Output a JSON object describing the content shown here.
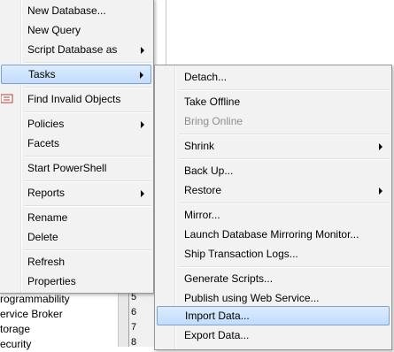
{
  "tree": {
    "rows": [
      "rogrammability",
      "ervice Broker",
      "torage",
      "ecurity"
    ]
  },
  "line_numbers": [
    "5",
    "6",
    "7",
    "8"
  ],
  "context_menu": {
    "items": [
      {
        "label": "New Database...",
        "submenu": false
      },
      {
        "label": "New Query",
        "submenu": false
      },
      {
        "label": "Script Database as",
        "submenu": true
      },
      {
        "label": "Tasks",
        "submenu": true,
        "highlighted": true
      },
      {
        "label": "Find Invalid Objects",
        "submenu": false
      },
      {
        "label": "Policies",
        "submenu": true
      },
      {
        "label": "Facets",
        "submenu": false
      },
      {
        "label": "Start PowerShell",
        "submenu": false
      },
      {
        "label": "Reports",
        "submenu": true
      },
      {
        "label": "Rename",
        "submenu": false
      },
      {
        "label": "Delete",
        "submenu": false
      },
      {
        "label": "Refresh",
        "submenu": false
      },
      {
        "label": "Properties",
        "submenu": false
      }
    ]
  },
  "tasks_submenu": {
    "items": [
      {
        "label": "Detach...",
        "submenu": false
      },
      {
        "label": "Take Offline",
        "submenu": false
      },
      {
        "label": "Bring Online",
        "submenu": false,
        "disabled": true
      },
      {
        "label": "Shrink",
        "submenu": true
      },
      {
        "label": "Back Up...",
        "submenu": false
      },
      {
        "label": "Restore",
        "submenu": true
      },
      {
        "label": "Mirror...",
        "submenu": false
      },
      {
        "label": "Launch Database Mirroring Monitor...",
        "submenu": false
      },
      {
        "label": "Ship Transaction Logs...",
        "submenu": false
      },
      {
        "label": "Generate Scripts...",
        "submenu": false
      },
      {
        "label": "Publish using Web Service...",
        "submenu": false
      },
      {
        "label": "Import Data...",
        "submenu": false,
        "highlighted": true
      },
      {
        "label": "Export Data...",
        "submenu": false
      }
    ]
  },
  "colors": {
    "menu_bg": "#f2f2f2",
    "highlight_border": "#7da2ce",
    "disabled_text": "#8d8d8d"
  }
}
